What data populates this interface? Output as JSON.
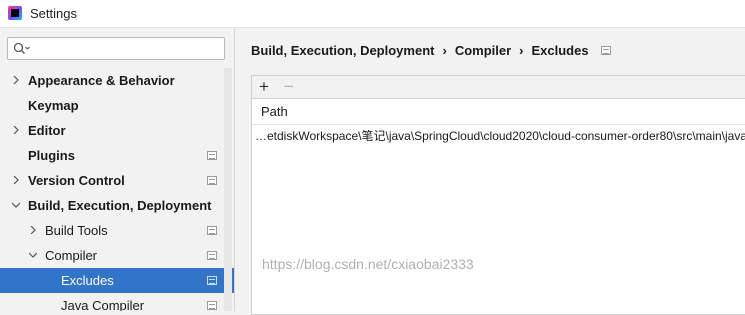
{
  "window": {
    "title": "Settings"
  },
  "search": {
    "value": "",
    "placeholder": ""
  },
  "sidebar": {
    "items": [
      {
        "label": "Appearance & Behavior",
        "bold": true,
        "expandable": true,
        "expanded": false
      },
      {
        "label": "Keymap",
        "bold": true,
        "expandable": false
      },
      {
        "label": "Editor",
        "bold": true,
        "expandable": true,
        "expanded": false
      },
      {
        "label": "Plugins",
        "bold": true,
        "expandable": false
      },
      {
        "label": "Version Control",
        "bold": true,
        "expandable": true,
        "expanded": false
      },
      {
        "label": "Build, Execution, Deployment",
        "bold": true,
        "expandable": true,
        "expanded": true
      },
      {
        "label": "Build Tools",
        "bold": false,
        "expandable": true,
        "expanded": false
      },
      {
        "label": "Compiler",
        "bold": false,
        "expandable": true,
        "expanded": true
      },
      {
        "label": "Excludes",
        "bold": false,
        "expandable": false,
        "selected": true
      },
      {
        "label": "Java Compiler",
        "bold": false,
        "expandable": false
      }
    ]
  },
  "breadcrumb": {
    "items": [
      "Build, Execution, Deployment",
      "Compiler",
      "Excludes"
    ],
    "separator": "›"
  },
  "toolbar": {
    "add_label": "+",
    "remove_label": "−"
  },
  "table": {
    "columns": [
      "Path"
    ],
    "rows": [
      "…etdiskWorkspace\\笔记\\java\\SpringCloud\\cloud2020\\cloud-consumer-order80\\src\\main\\java"
    ]
  },
  "watermark": "https://blog.csdn.net/cxiaobai2333",
  "colors": {
    "selection": "#3174c8",
    "background": "#f2f2f2"
  }
}
